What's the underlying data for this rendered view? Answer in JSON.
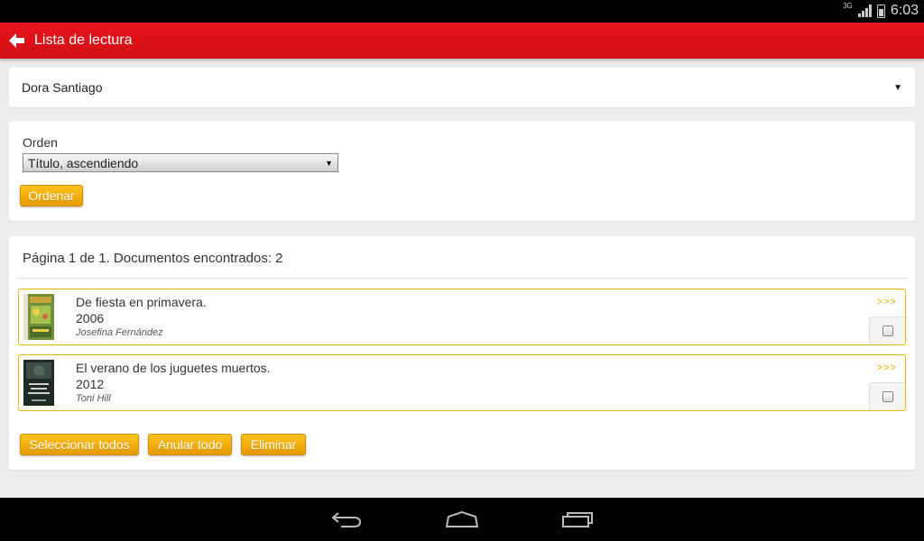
{
  "status_bar": {
    "network": "3G",
    "time": "6:03"
  },
  "app_bar": {
    "title": "Lista de lectura",
    "back_icon": "arrow-left-icon"
  },
  "user_selector": {
    "selected": "Dora Santiago"
  },
  "order": {
    "label": "Orden",
    "selected": "Título, ascendiendo",
    "button_label": "Ordenar"
  },
  "results": {
    "pager_text": "Página 1 de 1. Documentos encontrados: 2",
    "items": [
      {
        "title": "De fiesta en primavera.",
        "year": "2006",
        "author": "Josefina Fernández",
        "more": ">>>",
        "checked": false
      },
      {
        "title": "El verano de los juguetes muertos.",
        "year": "2012",
        "author": "Toni Hill",
        "more": ">>>",
        "checked": false
      }
    ],
    "select_all_label": "Seleccionar todos",
    "clear_all_label": "Anular todo",
    "delete_label": "Eliminar"
  },
  "colors": {
    "app_bar": "#e3141b",
    "accent": "#f5ac00",
    "background": "#ececec"
  }
}
